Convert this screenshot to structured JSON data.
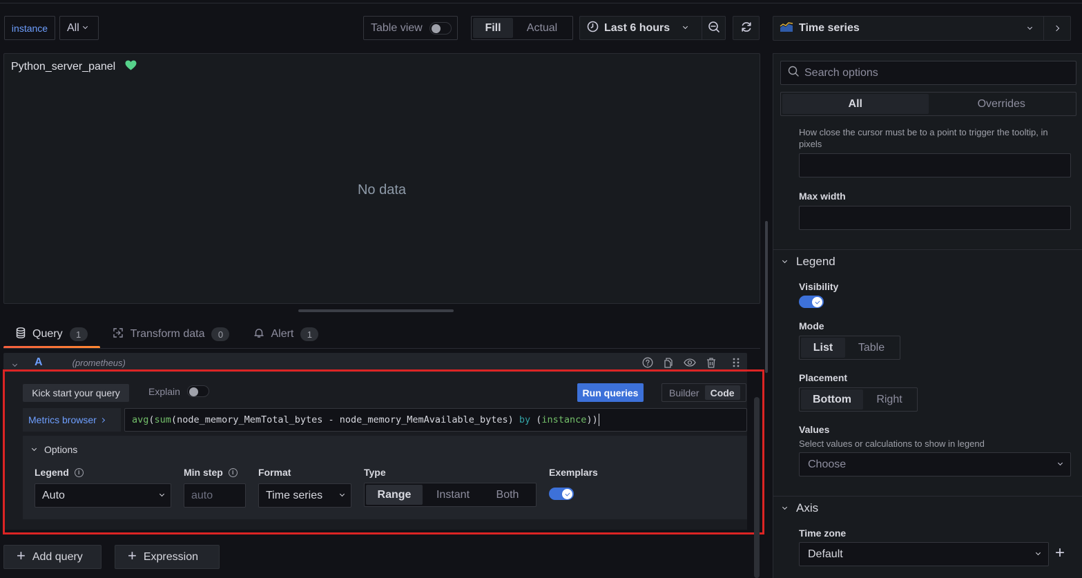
{
  "variables": {
    "name": "instance",
    "value": "All"
  },
  "toolbar": {
    "table_view_label": "Table view",
    "table_view_on": false,
    "fill_label": "Fill",
    "actual_label": "Actual",
    "active_size_mode": "Fill",
    "time_range": "Last 6 hours"
  },
  "visualization": {
    "type": "Time series"
  },
  "panel": {
    "title": "Python_server_panel",
    "health_color": "#56d28b",
    "empty_message": "No data"
  },
  "tabs": [
    {
      "label": "Query",
      "count": "1",
      "active": true
    },
    {
      "label": "Transform data",
      "count": "0",
      "active": false
    },
    {
      "label": "Alert",
      "count": "1",
      "active": false
    }
  ],
  "query": {
    "ref_id": "A",
    "datasource": "(prometheus)",
    "kick_start_label": "Kick start your query",
    "explain_label": "Explain",
    "explain_on": false,
    "run_label": "Run queries",
    "builder_label": "Builder",
    "code_label": "Code",
    "active_mode": "Code",
    "metrics_browser_label": "Metrics browser",
    "expr": {
      "fn_outer": "avg",
      "fn_inner": "sum",
      "body": "node_memory_MemTotal_bytes - node_memory_MemAvailable_bytes",
      "keyword": "by",
      "label": "instance"
    },
    "options": {
      "title": "Options",
      "legend_label": "Legend",
      "legend_value": "Auto",
      "min_step_label": "Min step",
      "min_step_placeholder": "auto",
      "format_label": "Format",
      "format_value": "Time series",
      "type_label": "Type",
      "type_options": [
        "Range",
        "Instant",
        "Both"
      ],
      "type_selected": "Range",
      "exemplars_label": "Exemplars",
      "exemplars_on": true
    },
    "add_query_label": "Add query",
    "expression_label": "Expression"
  },
  "options_pane": {
    "search_placeholder": "Search options",
    "tab_all": "All",
    "tab_overrides": "Overrides",
    "tooltip_hover_desc": "How close the cursor must be to a point to trigger the tooltip, in pixels",
    "max_width_label": "Max width",
    "legend": {
      "title": "Legend",
      "visibility_label": "Visibility",
      "visibility_on": true,
      "mode_label": "Mode",
      "mode_options": [
        "List",
        "Table"
      ],
      "mode_selected": "List",
      "placement_label": "Placement",
      "placement_options": [
        "Bottom",
        "Right"
      ],
      "placement_selected": "Bottom",
      "values_label": "Values",
      "values_desc": "Select values or calculations to show in legend",
      "values_placeholder": "Choose"
    },
    "axis": {
      "title": "Axis",
      "timezone_label": "Time zone",
      "timezone_value": "Default"
    }
  },
  "colors": {
    "accent": "#3d71d9",
    "link": "#6e9fff",
    "highlight_box": "#dc2424",
    "tab_underline": "#ff8833"
  }
}
